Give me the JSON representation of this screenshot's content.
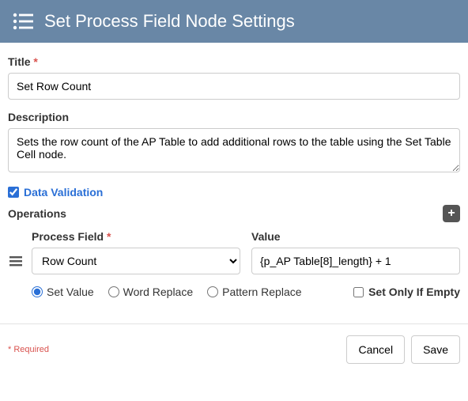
{
  "header": {
    "title": "Set Process Field Node Settings"
  },
  "title_field": {
    "label": "Title",
    "required_mark": "*",
    "value": "Set Row Count"
  },
  "description_field": {
    "label": "Description",
    "value": "Sets the row count of the AP Table to add additional rows to the table using the Set Table Cell node."
  },
  "data_validation": {
    "label": "Data Validation",
    "checked": true
  },
  "operations": {
    "label": "Operations",
    "items": [
      {
        "process_field": {
          "label": "Process Field",
          "required_mark": "*",
          "selected": "Row Count"
        },
        "value_field": {
          "label": "Value",
          "value": "{p_AP Table[8]_length} + 1"
        },
        "modes": {
          "set_value": "Set Value",
          "word_replace": "Word Replace",
          "pattern_replace": "Pattern Replace",
          "selected": "set_value"
        },
        "set_only_if_empty": {
          "label": "Set Only If Empty",
          "checked": false
        }
      }
    ]
  },
  "footer": {
    "required_note": "* Required",
    "cancel": "Cancel",
    "save": "Save"
  }
}
